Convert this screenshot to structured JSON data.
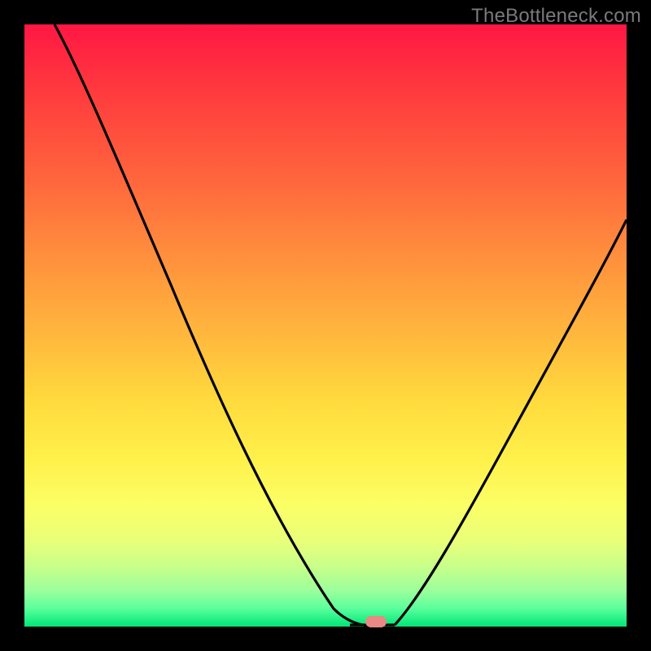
{
  "watermark": "TheBottleneck.com",
  "chart_data": {
    "type": "line",
    "title": "",
    "xlabel": "",
    "ylabel": "",
    "xlim": [
      0,
      100
    ],
    "ylim": [
      0,
      100
    ],
    "grid": false,
    "legend": false,
    "series": [
      {
        "name": "bottleneck-curve",
        "x": [
          5,
          10,
          15,
          20,
          25,
          30,
          35,
          40,
          45,
          50,
          53,
          55,
          57,
          60,
          65,
          70,
          75,
          80,
          85,
          90,
          95,
          100
        ],
        "y": [
          100,
          92,
          84,
          76,
          68,
          59,
          50,
          41,
          32,
          22,
          12,
          3,
          0,
          0,
          4,
          13,
          24,
          35,
          45,
          54,
          62,
          68
        ]
      }
    ],
    "annotations": [
      {
        "name": "optimal-marker",
        "x": 58.5,
        "y": 0.8
      }
    ],
    "background_gradient": {
      "top": "#ff1744",
      "mid": "#ffd93d",
      "bottom": "#00e676"
    }
  }
}
